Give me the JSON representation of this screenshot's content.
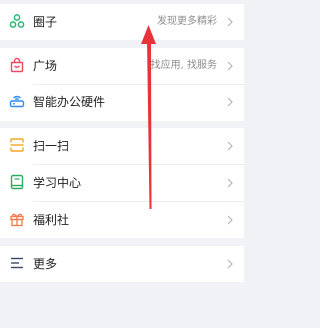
{
  "rows": [
    {
      "label": "圈子",
      "hint": "发现更多精彩"
    },
    {
      "label": "广场",
      "hint": "找应用, 找服务"
    },
    {
      "label": "智能办公硬件",
      "hint": ""
    },
    {
      "label": "扫一扫",
      "hint": ""
    },
    {
      "label": "学习中心",
      "hint": ""
    },
    {
      "label": "福利社",
      "hint": ""
    },
    {
      "label": "更多",
      "hint": ""
    }
  ],
  "icons": {
    "circle": "circle-group-icon",
    "square": "shopping-bag-icon",
    "hardware": "router-icon",
    "scan": "scan-icon",
    "learning": "book-icon",
    "welfare": "gift-icon",
    "more": "menu-icon"
  },
  "colors": {
    "icon_circle": "#2bb673",
    "icon_square": "#f04a5a",
    "icon_hardware": "#2f8cf0",
    "icon_scan": "#f5a623",
    "icon_learning": "#27ae60",
    "icon_welfare": "#f0784a",
    "icon_more": "#3a4a66",
    "annotation_arrow": "#e8333a"
  }
}
